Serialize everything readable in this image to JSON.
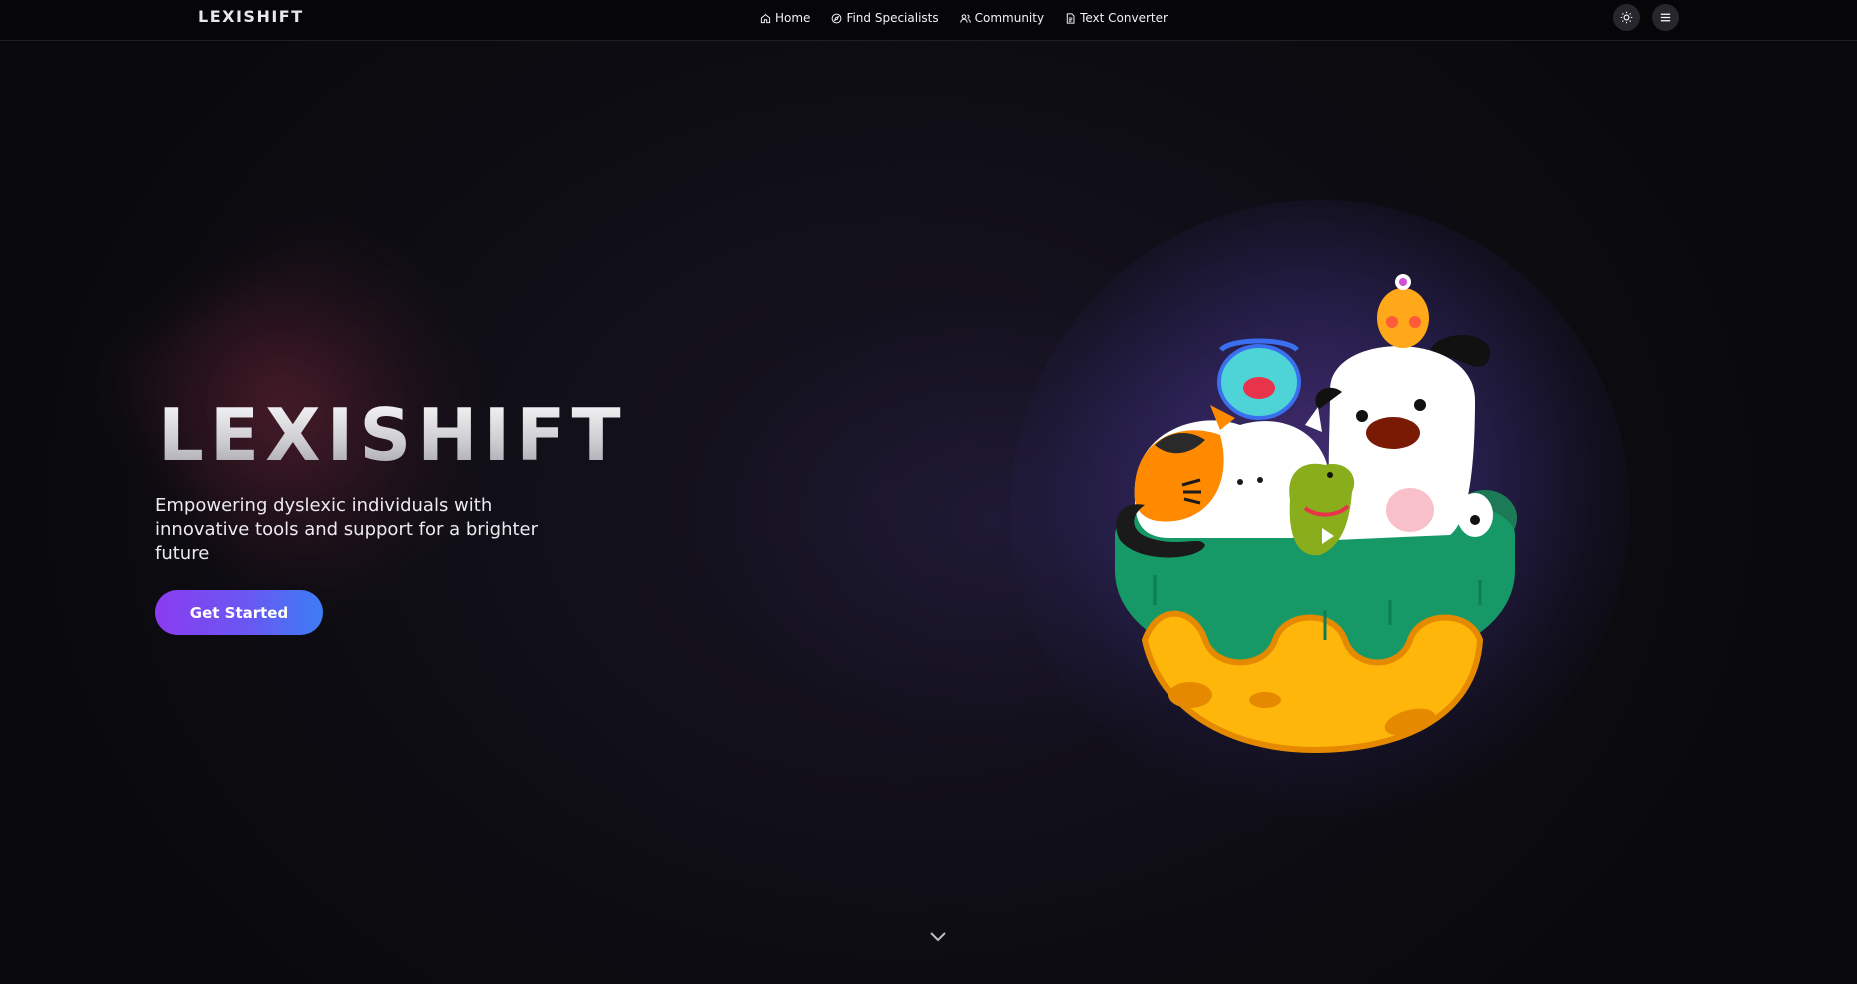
{
  "nav": {
    "brand": "LEXISHIFT",
    "links": [
      {
        "label": "Home",
        "icon": "home-icon"
      },
      {
        "label": "Find Specialists",
        "icon": "compass-icon"
      },
      {
        "label": "Community",
        "icon": "users-icon"
      },
      {
        "label": "Text Converter",
        "icon": "document-icon"
      }
    ],
    "theme_toggle_icon": "sun-icon",
    "menu_icon": "hamburger-icon"
  },
  "hero": {
    "title": "LEXISHIFT",
    "subtitle": "Empowering dyslexic individuals with innovative tools and support for a brighter future",
    "cta_label": "Get Started",
    "illustration": "cartoon-animals-planet",
    "scroll_icon": "chevron-down-icon"
  },
  "colors": {
    "cta_start": "#8a3cf0",
    "cta_end": "#3c7df4",
    "nav_bg": "#060608",
    "page_bg": "#0b0a10"
  }
}
